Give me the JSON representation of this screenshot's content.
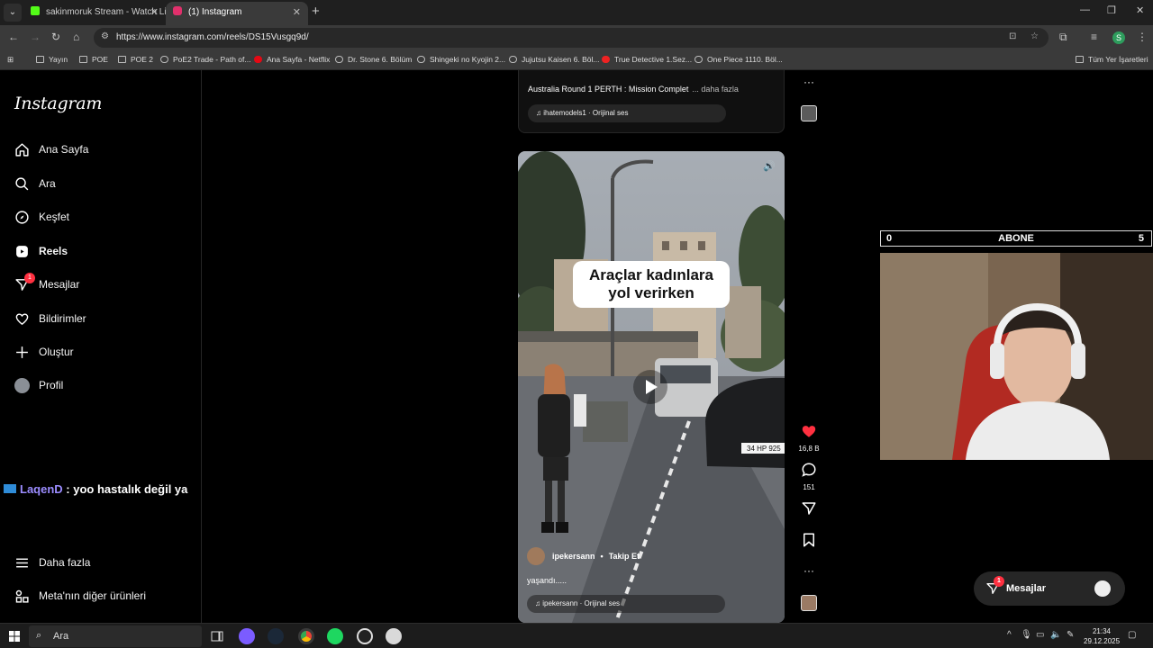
{
  "browser": {
    "tabs": [
      {
        "title": "sakinmoruk Stream - Watch Liv",
        "favicon_color": "#53fc18"
      },
      {
        "title": "(1) Instagram",
        "favicon_color": "#e1306c"
      }
    ],
    "url": "https://www.instagram.com/reels/DS15Vusgq9d/",
    "profile_initial": "S",
    "bookmarks": [
      "Yayın",
      "POE",
      "POE 2",
      "PoE2 Trade - Path of...",
      "Ana Sayfa - Netflix",
      "Dr. Stone 6. Bölüm",
      "Shingeki no Kyojin 2...",
      "Jujutsu Kaisen 6. Böl...",
      "True Detective 1.Sez...",
      "One Piece 1110. Böl..."
    ],
    "all_bookmarks": "Tüm Yer İşaretleri"
  },
  "sidebar": {
    "logo": "Instagram",
    "items": [
      {
        "label": "Ana Sayfa",
        "icon": "home-icon"
      },
      {
        "label": "Ara",
        "icon": "search-icon"
      },
      {
        "label": "Keşfet",
        "icon": "compass-icon"
      },
      {
        "label": "Reels",
        "icon": "reels-icon"
      },
      {
        "label": "Mesajlar",
        "icon": "messenger-icon",
        "badge": "1"
      },
      {
        "label": "Bildirimler",
        "icon": "heart-icon"
      },
      {
        "label": "Oluştur",
        "icon": "plus-icon"
      },
      {
        "label": "Profil",
        "icon": "avatar"
      }
    ],
    "more": "Daha fazla",
    "meta": "Meta'nın diğer ürünleri"
  },
  "chat_overlay": {
    "user": "LaqenD",
    "message": ": yoo hastalık değil ya"
  },
  "previous_reel": {
    "caption": "Australia Round 1 PERTH : Mission Complet",
    "more": "... daha fazla",
    "audio": "ihatemodels1 · Orijinal ses"
  },
  "reel": {
    "overlay_text": "Araçlar kadınlara yol verirken",
    "plate": "34 HP 925",
    "author": "ipekersann",
    "follow": "Takip Et",
    "description": "yaşandı.....",
    "audio": "ipekersann · Orijinal ses",
    "likes": "16,8 B",
    "comments": "151"
  },
  "stream_overlay": {
    "left": "0",
    "center": "ABONE",
    "right": "5"
  },
  "messages_pill": {
    "label": "Mesajlar",
    "badge": "1"
  },
  "taskbar": {
    "search": "Ara",
    "time": "21:34",
    "date": "29.12.2025"
  }
}
